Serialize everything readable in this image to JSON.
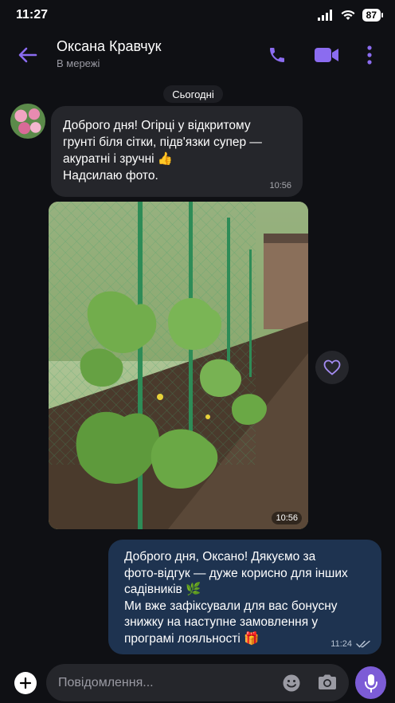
{
  "status_bar": {
    "time": "11:27",
    "battery": "87"
  },
  "header": {
    "contact_name": "Оксана Кравчук",
    "contact_status": "В мережі"
  },
  "chat": {
    "date_chip": "Сьогодні",
    "incoming_message": {
      "text": "Доброго дня! Огірці у відкритому\nгрунті біля сітки, підв'язки супер —\nакуратні і зручні 👍\nНадсилаю фото.",
      "time": "10:56"
    },
    "photo_message": {
      "time": "10:56"
    },
    "outgoing_message": {
      "text": "Доброго дня, Оксано! Дякуємо за\nфото-відгук — дуже корисно для інших\nсадівників 🌿\nМи вже зафіксували для вас бонусну\nзнижку на наступне замовлення у\nпрограмі лояльності 🎁",
      "time": "11:24"
    }
  },
  "composer": {
    "placeholder": "Повідомлення..."
  },
  "colors": {
    "accent": "#8b6cf0",
    "background": "#0f1014",
    "incoming_bubble": "#25262b",
    "outgoing_bubble": "#1e3350"
  },
  "icons": [
    "back-arrow-icon",
    "phone-icon",
    "video-icon",
    "more-icon",
    "heart-icon",
    "plus-icon",
    "emoji-icon",
    "camera-icon",
    "mic-icon",
    "read-receipt-icon"
  ]
}
